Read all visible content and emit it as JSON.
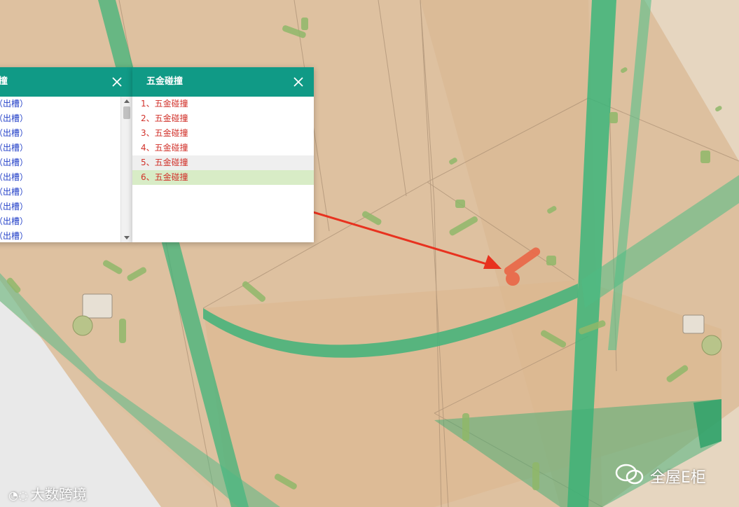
{
  "left_panel": {
    "title": "撞",
    "items": [
      "（出槽）",
      "（出槽）",
      "（出槽）",
      "（出槽）",
      "（出槽）",
      "（出槽）",
      "（出槽）",
      "（出槽）",
      "（出槽）",
      "（出槽）"
    ]
  },
  "right_panel": {
    "title": "五金碰撞",
    "items": [
      {
        "label": "1、五金碰撞"
      },
      {
        "label": "2、五金碰撞"
      },
      {
        "label": "3、五金碰撞"
      },
      {
        "label": "4、五金碰撞"
      },
      {
        "label": "5、五金碰撞",
        "state": "hover"
      },
      {
        "label": "6、五金碰撞",
        "state": "selected"
      }
    ]
  },
  "watermarks": {
    "bottom_left": "大数跨境",
    "bottom_right": "全屋E柜"
  },
  "colors": {
    "header": "#109a86",
    "item_text_red": "#d1312a",
    "item_text_blue": "#2441c8",
    "selected_bg": "#d8ecc6",
    "arrow": "#e8321f"
  }
}
